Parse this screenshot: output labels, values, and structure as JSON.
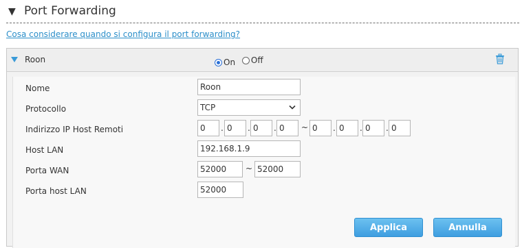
{
  "section": {
    "title": "Port Forwarding",
    "toggle_icon": "triangle-down-icon"
  },
  "help_link": "Cosa considerare quando si configura il port forwarding?",
  "rule": {
    "name": "Roon",
    "status": {
      "on_label": "On",
      "off_label": "Off",
      "selected": "On"
    },
    "delete_icon": "trash-icon",
    "accent_color": "#3a9bd8"
  },
  "form": {
    "nome": {
      "label": "Nome",
      "value": "Roon"
    },
    "protocollo": {
      "label": "Protocollo",
      "value": "TCP"
    },
    "remote_ip": {
      "label": "Indirizzo IP Host Remoti",
      "start": [
        "0",
        "0",
        "0",
        "0"
      ],
      "end": [
        "0",
        "0",
        "0",
        "0"
      ],
      "dot": ".",
      "range_sep": "~"
    },
    "host_lan": {
      "label": "Host LAN",
      "value": "192.168.1.9"
    },
    "porta_wan": {
      "label": "Porta WAN",
      "start": "52000",
      "end": "52000",
      "range_sep": "~"
    },
    "porta_host_lan": {
      "label": "Porta host LAN",
      "value": "52000"
    }
  },
  "buttons": {
    "apply_label": "Applica",
    "cancel_label": "Annulla"
  }
}
